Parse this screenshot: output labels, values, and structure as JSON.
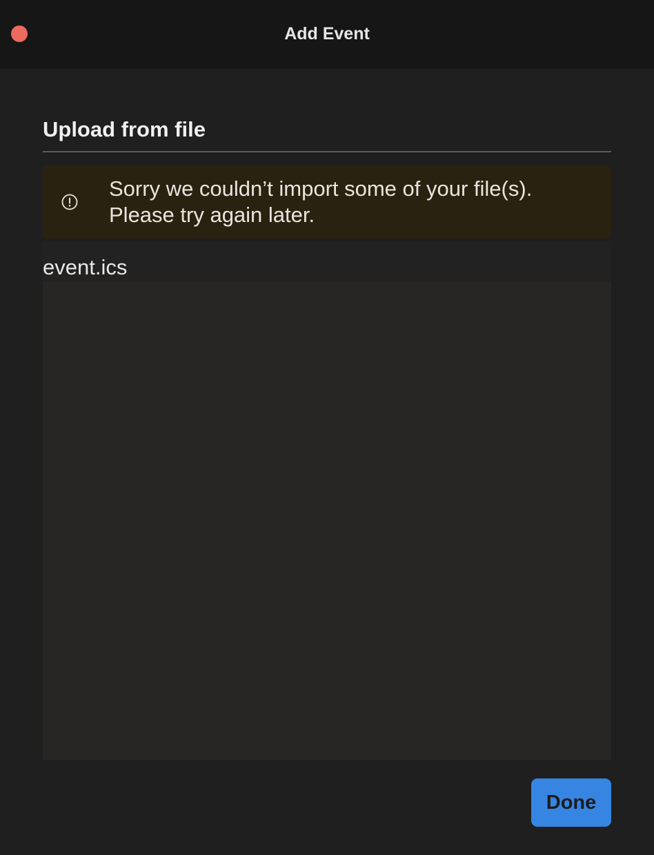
{
  "window": {
    "title": "Add Event"
  },
  "upload": {
    "section_title": "Upload from file"
  },
  "error_banner": {
    "icon": "alert-circle-icon",
    "lines": [
      "Sorry we couldn’t import some of your file(s).",
      "Please try again later."
    ]
  },
  "files": [
    {
      "name": "event.ics"
    }
  ],
  "actions": {
    "done_label": "Done"
  },
  "colors": {
    "close_button": "#ec6a5e",
    "primary_button": "#3685e3",
    "warning_background": "#2a2210",
    "window_background": "#1f1f1f"
  }
}
